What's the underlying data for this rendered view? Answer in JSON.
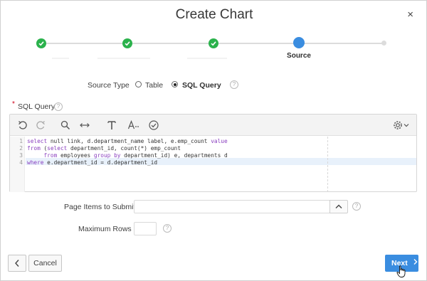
{
  "dialog": {
    "title": "Create Chart",
    "close_label": "×"
  },
  "wizard": {
    "current_step_label": "Source"
  },
  "source_type": {
    "label": "Source Type",
    "options": [
      {
        "label": "Table",
        "selected": false
      },
      {
        "label": "SQL Query",
        "selected": true
      }
    ],
    "help": "?"
  },
  "sql_query": {
    "label": "SQL Query",
    "required_marker": "*",
    "help": "?",
    "toolbar_icons": [
      "undo-icon",
      "redo-icon",
      "search-icon",
      "replace-icon",
      "format-icon",
      "autocomplete-icon",
      "validate-icon",
      "settings-icon"
    ],
    "line_numbers": [
      "1",
      "2",
      "3",
      "4"
    ],
    "lines": [
      [
        "select",
        " null link, d.department_name label, e.emp_count ",
        "value"
      ],
      [
        "from",
        " (",
        "select",
        " department_id, count(*) emp_count"
      ],
      [
        "     ",
        "from",
        " employees ",
        "group by",
        " department_id) e, departments d"
      ],
      [
        "where",
        " e.department_id = d.department_id"
      ]
    ]
  },
  "page_items": {
    "label": "Page Items to Submit",
    "value": "",
    "help": "?"
  },
  "max_rows": {
    "label": "Maximum Rows",
    "value": "",
    "help": "?"
  },
  "footer": {
    "cancel_label": "Cancel",
    "next_label": "Next"
  },
  "colors": {
    "primary": "#3a8de0",
    "complete": "#2bb24c",
    "required": "#d0021b",
    "keyword": "#8a3fbf"
  }
}
